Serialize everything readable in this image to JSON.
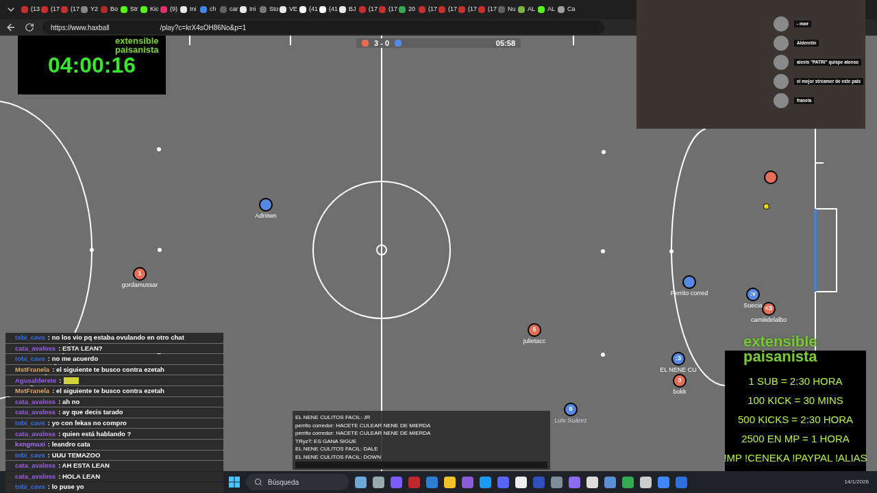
{
  "browser": {
    "tabs": [
      {
        "label": "(13",
        "color": "#c4302b"
      },
      {
        "label": "(17",
        "color": "#c4302b"
      },
      {
        "label": "(17",
        "color": "#c4302b"
      },
      {
        "label": "Y2",
        "color": "#888888"
      },
      {
        "label": "Bo",
        "color": "#b02a2a"
      },
      {
        "label": "Str",
        "color": "#53fc18"
      },
      {
        "label": "Kic",
        "color": "#53fc18"
      },
      {
        "label": "(9)",
        "color": "#e1306c"
      },
      {
        "label": "Ini",
        "color": "#e8e8e8"
      },
      {
        "label": "ch",
        "color": "#4285f4"
      },
      {
        "label": "car",
        "color": "#5f6368"
      },
      {
        "label": "Ini",
        "color": "#e8e8e8"
      },
      {
        "label": "Sto",
        "color": "#777777"
      },
      {
        "label": "VE",
        "color": "#e8e8e8"
      },
      {
        "label": "(41",
        "color": "#ffffff"
      },
      {
        "label": "(41",
        "color": "#ffffff"
      },
      {
        "label": "BJ",
        "color": "#e8e8e8"
      },
      {
        "label": "(17",
        "color": "#c4302b"
      },
      {
        "label": "(17",
        "color": "#c4302b"
      },
      {
        "label": "20",
        "color": "#34a853"
      },
      {
        "label": "(17",
        "color": "#c4302b"
      },
      {
        "label": "(17",
        "color": "#c4302b"
      },
      {
        "label": "(17",
        "color": "#c4302b"
      },
      {
        "label": "(17",
        "color": "#c4302b"
      },
      {
        "label": "Nu",
        "color": "#5f6368"
      },
      {
        "label": "AL",
        "color": "#7cb342"
      },
      {
        "label": "AL",
        "color": "#53fc18"
      },
      {
        "label": "Ca",
        "color": "#9aa0a6"
      }
    ],
    "url_start": "https://www.haxball",
    "url_end": "/play?c=krX4sOH86No&p=1"
  },
  "stream_logo": {
    "line_1": "extensible",
    "line_2": "paisanista"
  },
  "timer": "04:00:16",
  "scoreboard": {
    "score": "3 - 0",
    "time": "05:58"
  },
  "players": [
    {
      "name": "Adriiiwn",
      "color": "#5688e5"
    },
    {
      "avatar": "1",
      "name": "gordamussar",
      "color": "#e56e56"
    },
    {
      "avatar": "5",
      "name": "julietacc",
      "color": "#e56e56"
    },
    {
      "name": "Perrito corred",
      "color": "#5688e5"
    },
    {
      "avatar": ":v",
      "name": "Suecia",
      "color": "#5688e5"
    },
    {
      "avatar": "<3",
      "name": "camiiidelalbo",
      "color": "#e56e56"
    },
    {
      "avatar": ":3",
      "name": "EL NENE CU",
      "color": "#5688e5"
    },
    {
      "avatar": "3",
      "name": "bokk",
      "color": "#e56e56"
    },
    {
      "avatar": "9",
      "name": "Luis Suárez",
      "color": "#5688e5"
    },
    {
      "color": "#e56e56"
    }
  ],
  "stream_chat": [
    {
      "user": "tobi_cavs",
      "color": "#3b6fd8",
      "text": ": no los vio pq estaba ovulando en otro chat"
    },
    {
      "user": "cata_avaloss",
      "color": "#9b5cf0",
      "text": ": ESTA LEAN?"
    },
    {
      "user": "tobi_cavs",
      "color": "#3b6fd8",
      "text": ": no me acuerdo"
    },
    {
      "user": "MstFranela",
      "color": "#e0a562",
      "text": ": el siguiente te busco contra ezetah"
    },
    {
      "user": "Agusalderete",
      "color": "#9b5cf0",
      "kind": "emote",
      "text": ":"
    },
    {
      "user": "MstFranela",
      "color": "#e0a562",
      "text": ": el siguiente te busco contra ezetah"
    },
    {
      "user": "cata_avaloss",
      "color": "#9b5cf0",
      "text": ": ah no"
    },
    {
      "user": "cata_avaloss",
      "color": "#9b5cf0",
      "text": ": ay que decis tarado"
    },
    {
      "user": "tobi_cavs",
      "color": "#3b6fd8",
      "text": ": yo con fekas no compro"
    },
    {
      "user": "cata_avaloss",
      "color": "#9b5cf0",
      "text": ": quien está hablando ?"
    },
    {
      "user": "kxngmaxi",
      "color": "#a070f0",
      "text": ": leandro cata"
    },
    {
      "user": "tobi_cavs",
      "color": "#3b6fd8",
      "text": ": UUU TEMAZOO"
    },
    {
      "user": "cata_avaloss",
      "color": "#9b5cf0",
      "text": ": AH ESTA LEAN"
    },
    {
      "user": "cata_avaloss",
      "color": "#9b5cf0",
      "text": ": HOLA LEAN"
    },
    {
      "user": "tobi_cavs",
      "color": "#3b6fd8",
      "text": ": lo puse yo"
    }
  ],
  "game_chat": [
    "EL NENE CULITOS FACIL: JR",
    "perrito corredor: HACETE CULEAR NENE DE MIERDA",
    "perrito corredor: HACETE CULEAR NENE DE MIERDA",
    "TRyzT: ES GANA SIGUE",
    "EL NENE CULITOS FACIL: DALE",
    "EL NENE CULITOS FACIL: DOWN"
  ],
  "voice_users": [
    "- mwr",
    "Alderetin",
    "alexis \"PATRI\" quispe alonso",
    "el mejor streamer de este pais",
    "franela"
  ],
  "promo": {
    "logo_line_1": "extensible",
    "logo_line_2": "paisanista",
    "lines": [
      "1 SUB = 2:30 HORA",
      "100 KICK = 30 MINS",
      "500 KICKS = 2:30 HORA",
      "2500 EN MP = 1 HORA",
      "!MP !CENEKA !PAYPAL !ALIAS"
    ]
  },
  "taskbar": {
    "search_placeholder": "Búsqueda",
    "date": "14/1/2026"
  }
}
